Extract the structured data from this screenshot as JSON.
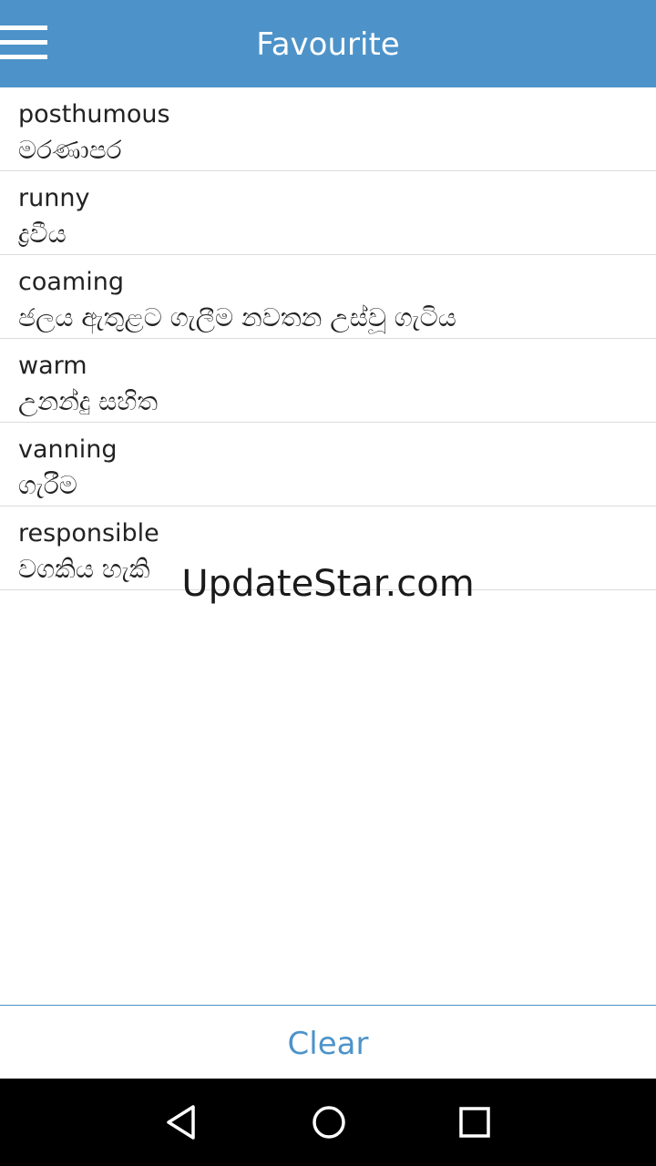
{
  "app_bar": {
    "title": "Favourite",
    "menu_icon": "hamburger-menu-icon",
    "background_color": "#4d93c9"
  },
  "favourites": [
    {
      "word": "posthumous",
      "meaning": "මරණාපර"
    },
    {
      "word": "runny",
      "meaning": "ද්‍රවීය"
    },
    {
      "word": "coaming",
      "meaning": "ජලය ඇතුළට ගැලීම නවතන උස්වූ ගැටිය"
    },
    {
      "word": "warm",
      "meaning": "උනන්දු සහිත"
    },
    {
      "word": "vanning",
      "meaning": "ගැරීම"
    },
    {
      "word": "responsible",
      "meaning": "වගකිය හැකි"
    }
  ],
  "watermark": "UpdateStar.com",
  "bottom": {
    "clear_label": "Clear",
    "accent_color": "#4d93c9"
  },
  "system_nav": {
    "back_icon": "back-triangle-icon",
    "home_icon": "home-circle-icon",
    "recents_icon": "recents-square-icon"
  }
}
